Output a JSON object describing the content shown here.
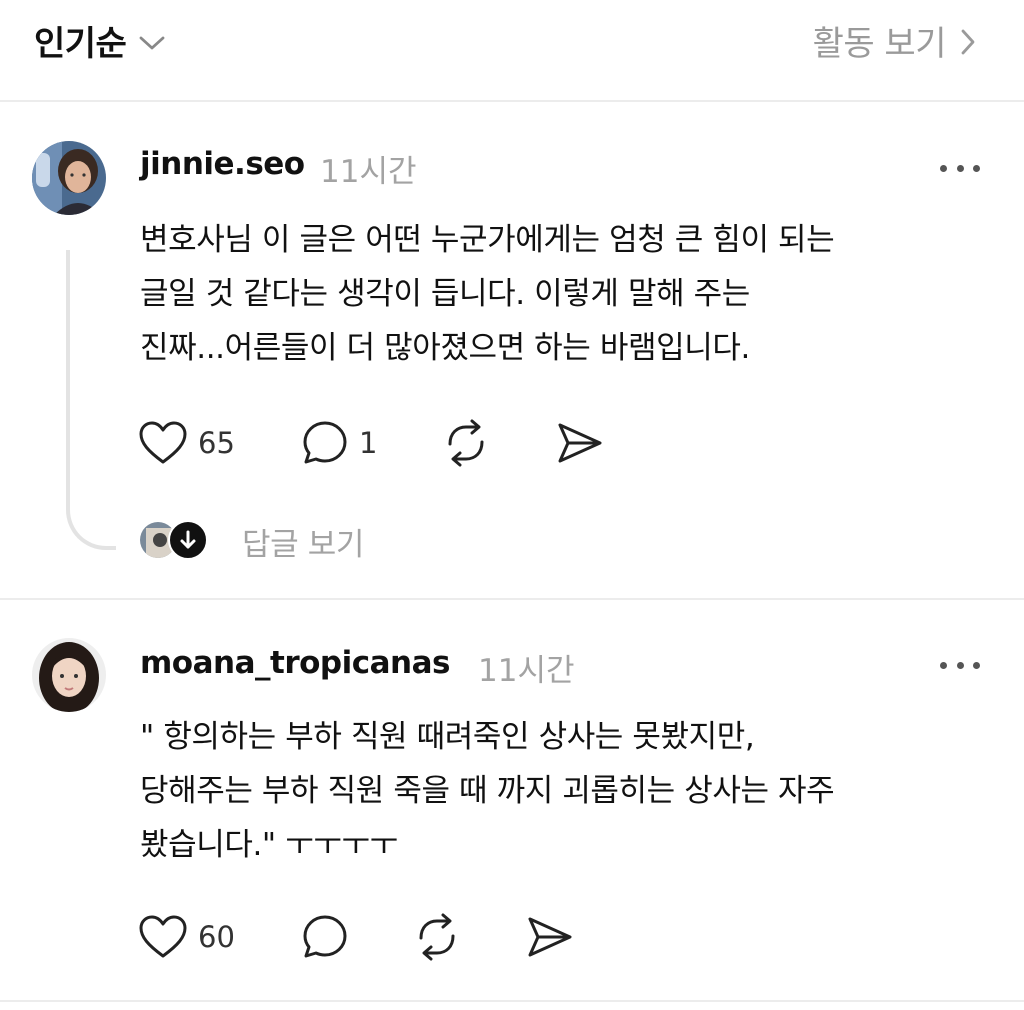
{
  "header": {
    "sort_label": "인기순",
    "activity_label": "활동 보기"
  },
  "comments": [
    {
      "username": "jinnie.seo",
      "time": "11시간",
      "lines": [
        "변호사님 이 글은 어떤 누군가에게는 엄청 큰 힘이 되는",
        "글일 것 같다는 생각이 듭니다. 이렇게 말해 주는",
        "진짜...어른들이 더 많아졌으면 하는 바램입니다."
      ],
      "likes": "65",
      "replies_count": "1",
      "view_replies_label": "답글 보기"
    },
    {
      "username": "moana_tropicanas",
      "time": "11시간",
      "lines": [
        "\" 항의하는 부하 직원 때려죽인 상사는 못봤지만,",
        "당해주는 부하 직원 죽을 때 까지 괴롭히는 상사는 자주",
        "봤습니다.\" ㅜㅜㅜㅜ"
      ],
      "likes": "60"
    }
  ],
  "icons": {
    "sort": "chevron-down-icon",
    "activity": "chevron-right-icon",
    "like": "heart-icon",
    "reply": "comment-bubble-icon",
    "repost": "repost-icon",
    "share": "send-icon",
    "more": "more-horizontal-icon",
    "expand": "arrow-down-icon"
  },
  "colors": {
    "text": "#111111",
    "muted": "#9a9a9a",
    "divider": "#ececec",
    "thread_line": "#e3e3e3"
  }
}
